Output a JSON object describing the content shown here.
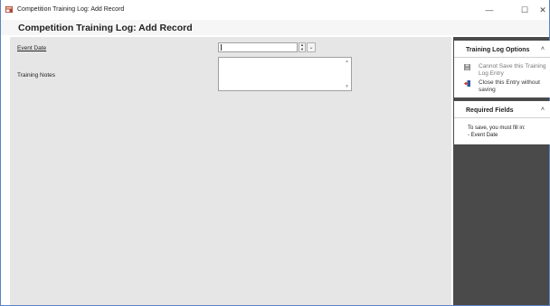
{
  "window": {
    "title": "Competition Training Log: Add Record",
    "minimize_glyph": "—",
    "maximize_glyph": "☐",
    "close_glyph": "✕",
    "app_icon": "training-log-app-icon"
  },
  "header": {
    "title": "Competition Training Log: Add Record"
  },
  "form": {
    "event_date_label": "Event Date",
    "event_date_value": "",
    "training_notes_label": "Training Notes",
    "training_notes_value": ""
  },
  "sidebar": {
    "options_panel": {
      "title": "Training Log Options",
      "collapse_glyph": "˄",
      "save_label": "Cannot Save this Training Log Entry",
      "close_label": "Close this Entry without saving"
    },
    "required_panel": {
      "title": "Required Fields",
      "collapse_glyph": "˄",
      "line1": "To save, you must fill in:",
      "line2": "- Event Date"
    }
  },
  "colors": {
    "window_border": "#5b84c4",
    "sidebar_bg": "#4a4a4a",
    "content_bg": "#e6e6e6"
  }
}
